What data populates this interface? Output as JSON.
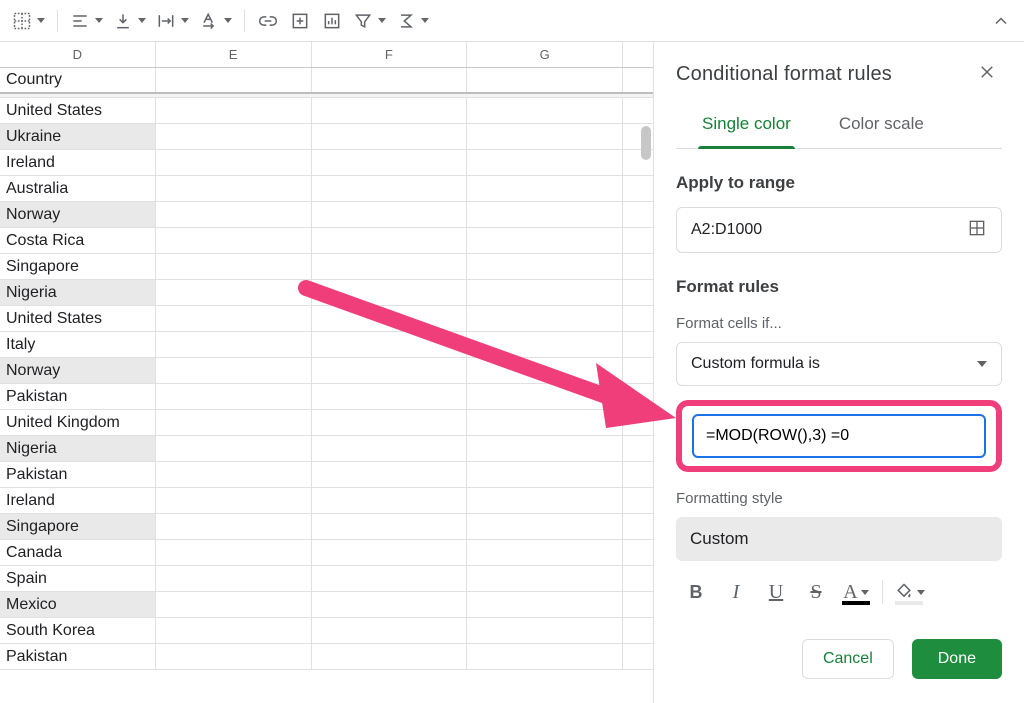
{
  "toolbar": {},
  "sheet": {
    "columns": [
      "D",
      "E",
      "F",
      "G",
      ""
    ],
    "header_cell": "Country",
    "rows": [
      "United States",
      "Ukraine",
      "Ireland",
      "Australia",
      "Norway",
      "Costa Rica",
      "Singapore",
      "Nigeria",
      "United States",
      "Italy",
      "Norway",
      "Pakistan",
      "United Kingdom",
      "Nigeria",
      "Pakistan",
      "Ireland",
      "Singapore",
      "Canada",
      "Spain",
      "Mexico",
      "South Korea",
      "Pakistan"
    ],
    "alt_indices": [
      1,
      4,
      7,
      10,
      13,
      16,
      19
    ]
  },
  "panel": {
    "title": "Conditional format rules",
    "tabs": {
      "single": "Single color",
      "scale": "Color scale"
    },
    "apply_label": "Apply to range",
    "range_value": "A2:D1000",
    "format_rules_label": "Format rules",
    "format_if_label": "Format cells if...",
    "condition_value": "Custom formula is",
    "formula_value": "=MOD(ROW(),3) =0",
    "style_label": "Formatting style",
    "style_value": "Custom",
    "cancel": "Cancel",
    "done": "Done",
    "text_tools": {
      "bold": "B",
      "italic": "I",
      "underline": "U",
      "strike": "S",
      "textcolor": "A"
    }
  }
}
